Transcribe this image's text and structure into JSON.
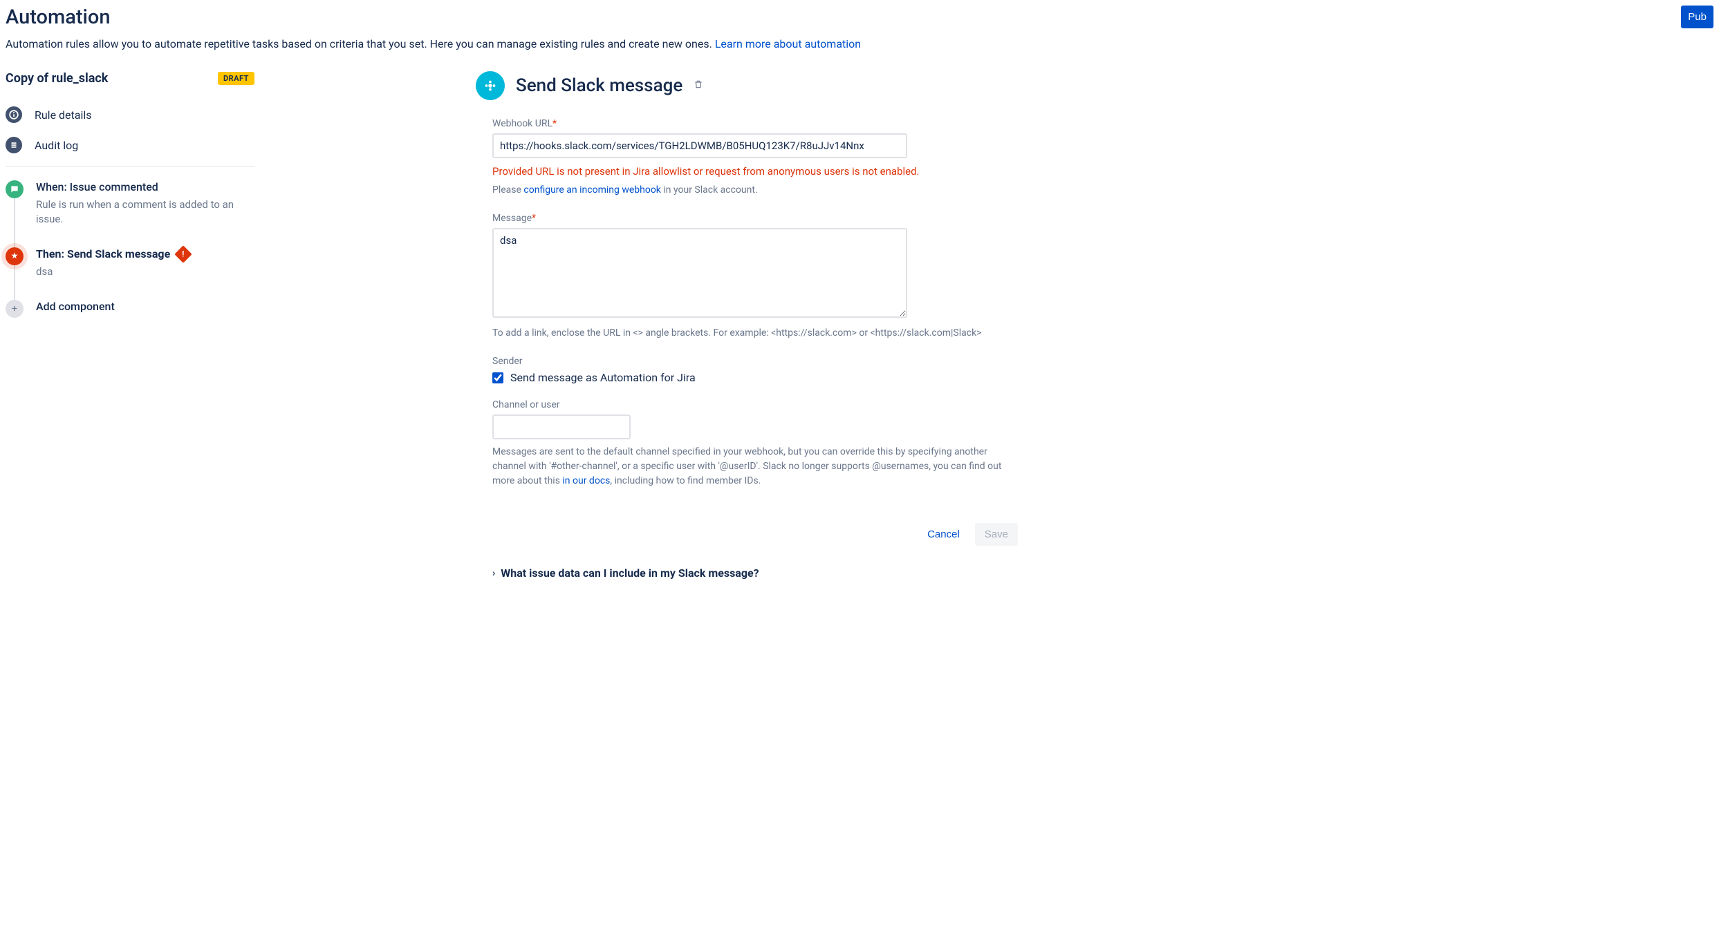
{
  "page": {
    "title": "Automation",
    "description": "Automation rules allow you to automate repetitive tasks based on criteria that you set. Here you can manage existing rules and create new ones. ",
    "learn_link": "Learn more about automation",
    "publish_label": "Pub"
  },
  "rule": {
    "name": "Copy of rule_slack",
    "draft_label": "DRAFT",
    "nav": {
      "details": "Rule details",
      "audit": "Audit log"
    },
    "steps": {
      "trigger": {
        "title": "When: Issue commented",
        "sub": "Rule is run when a comment is added to an issue."
      },
      "action": {
        "title": "Then: Send Slack message",
        "sub": "dsa"
      },
      "add": {
        "title": "Add component"
      }
    }
  },
  "panel": {
    "title": "Send Slack message",
    "webhook": {
      "label": "Webhook URL",
      "value": "https://hooks.slack.com/services/TGH2LDWMB/B05HUQ123K7/R8uJJv14Nnx",
      "error": "Provided URL is not present in Jira allowlist or request from anonymous users is not enabled.",
      "help_pre": "Please ",
      "help_link": "configure an incoming webhook",
      "help_post": " in your Slack account."
    },
    "message": {
      "label": "Message",
      "value": "dsa",
      "help": "To add a link, enclose the URL in <> angle brackets. For example: <https://slack.com> or <https://slack.com|Slack>"
    },
    "sender": {
      "label": "Sender",
      "checkbox_label": "Send message as Automation for Jira"
    },
    "channel": {
      "label": "Channel or user",
      "value": "",
      "help_pre": "Messages are sent to the default channel specified in your webhook, but you can override this by specifying another channel with '#other-channel', or a specific user with '@userID'. Slack no longer supports @usernames, you can find out more about this ",
      "help_link": "in our docs",
      "help_post": ", including how to find member IDs."
    },
    "buttons": {
      "cancel": "Cancel",
      "save": "Save"
    },
    "expando": "What issue data can I include in my Slack message?"
  }
}
